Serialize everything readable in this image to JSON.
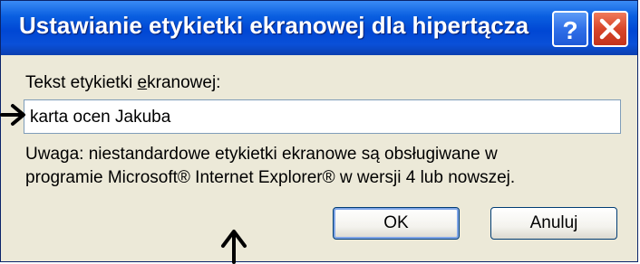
{
  "dialog": {
    "title": "Ustawianie etykietki ekranowej dla hipertącza",
    "help_icon": "help-icon",
    "close_icon": "close-icon",
    "field_label_pre": "Tekst etykietki ",
    "field_label_accel": "e",
    "field_label_post": "kranowej:",
    "field_value": "karta ocen Jakuba",
    "note_line1": "Uwaga: niestandardowe etykietki ekranowe są obsługiwane w",
    "note_line2": "programie Microsoft® Internet Explorer® w wersji 4 lub nowszej.",
    "ok_label": "OK",
    "cancel_label": "Anuluj"
  },
  "annotations": {
    "left_arrow_icon": "arrow-right-icon",
    "bottom_arrow_icon": "arrow-up-icon"
  },
  "colors": {
    "titlebar": "#0047d4",
    "dialog_bg": "#ece9d8",
    "close_button": "#d8462a"
  }
}
